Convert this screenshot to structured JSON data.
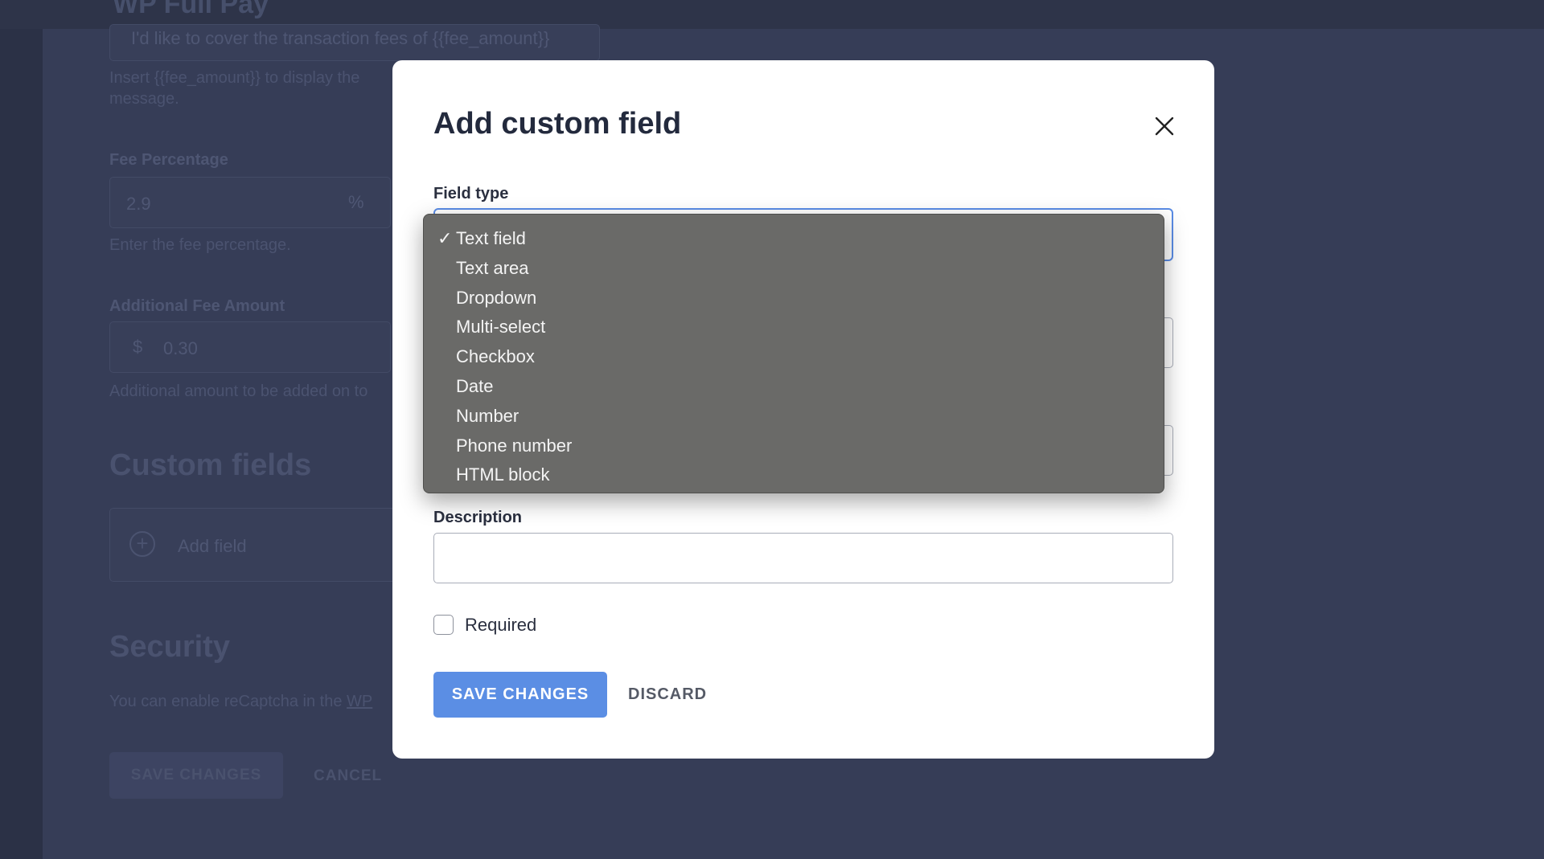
{
  "background": {
    "page_title": "WP Full Pay",
    "fee_message_value": "I'd like to cover the transaction fees of {{fee_amount}}",
    "fee_message_help_1": "Insert {{fee_amount}} to display the",
    "fee_message_help_2": "message.",
    "fee_percentage_label": "Fee Percentage",
    "fee_percentage_value": "2.9",
    "fee_percentage_suffix": "%",
    "fee_percentage_help": "Enter the fee percentage.",
    "additional_fee_label": "Additional Fee Amount",
    "additional_fee_prefix": "$",
    "additional_fee_value": "0.30",
    "additional_fee_help": "Additional amount to be added on to",
    "custom_fields_heading": "Custom fields",
    "add_field_label": "Add field",
    "security_heading": "Security",
    "security_text": "You can enable reCaptcha in the",
    "security_link": "WP",
    "save_changes_label": "SAVE CHANGES",
    "cancel_label": "CANCEL"
  },
  "modal": {
    "title": "Add custom field",
    "field_type_label": "Field type",
    "description_label": "Description",
    "required_label": "Required",
    "required_checked": false,
    "save_label": "SAVE CHANGES",
    "discard_label": "DISCARD"
  },
  "dropdown": {
    "selected_marker": "✓",
    "options": [
      {
        "label": "Text field",
        "selected": true
      },
      {
        "label": "Text area",
        "selected": false
      },
      {
        "label": "Dropdown",
        "selected": false
      },
      {
        "label": "Multi-select",
        "selected": false
      },
      {
        "label": "Checkbox",
        "selected": false
      },
      {
        "label": "Date",
        "selected": false
      },
      {
        "label": "Number",
        "selected": false
      },
      {
        "label": "Phone number",
        "selected": false
      },
      {
        "label": "HTML block",
        "selected": false
      }
    ]
  },
  "colors": {
    "overlay": "#333a52",
    "accent": "#5b8ee4",
    "focus_border": "#5a8ce6",
    "dropdown_bg": "#6a6a68"
  }
}
